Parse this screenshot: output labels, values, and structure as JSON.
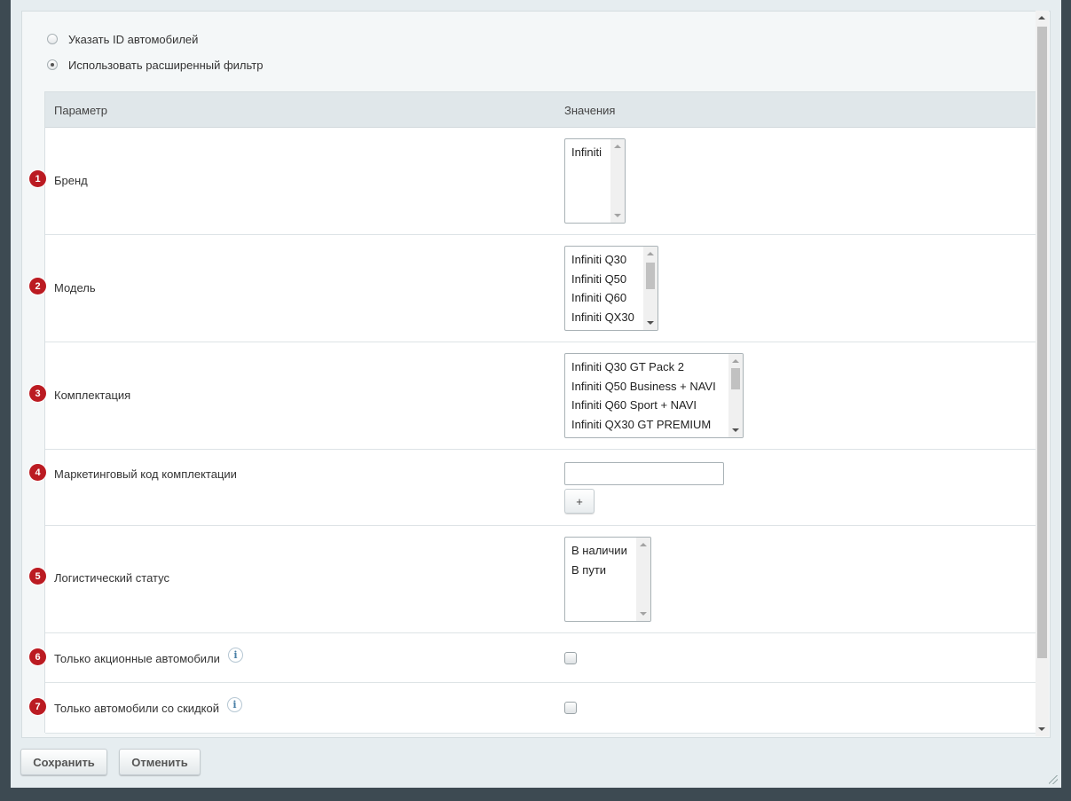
{
  "filter_mode": {
    "options": [
      {
        "label": "Указать ID автомобилей",
        "checked": false
      },
      {
        "label": "Использовать расширенный фильтр",
        "checked": true
      }
    ]
  },
  "table": {
    "headers": {
      "param": "Параметр",
      "values": "Значения"
    },
    "rows": [
      {
        "number": "1",
        "label": "Бренд",
        "type": "listbox",
        "options": [
          "Infiniti"
        ]
      },
      {
        "number": "2",
        "label": "Модель",
        "type": "listbox",
        "options": [
          "Infiniti Q30",
          "Infiniti Q50",
          "Infiniti Q60",
          "Infiniti QX30"
        ]
      },
      {
        "number": "3",
        "label": "Комплектация",
        "type": "listbox",
        "options": [
          "Infiniti Q30 GT Pack 2",
          "Infiniti Q50 Business + NAVI",
          "Infiniti Q60 Sport + NAVI",
          "Infiniti QX30 GT PREMIUM"
        ]
      },
      {
        "number": "4",
        "label": "Маркетинговый код комплектации",
        "type": "text",
        "value": "",
        "add_label": "+"
      },
      {
        "number": "5",
        "label": "Логистический статус",
        "type": "listbox",
        "options": [
          "В наличии",
          "В пути"
        ]
      },
      {
        "number": "6",
        "label": "Только акционные автомобили",
        "type": "checkbox",
        "checked": false,
        "info_icon": "i"
      },
      {
        "number": "7",
        "label": "Только автомобили со скидкой",
        "type": "checkbox",
        "checked": false,
        "info_icon": "i"
      }
    ]
  },
  "footer": {
    "save_label": "Сохранить",
    "cancel_label": "Отменить"
  }
}
